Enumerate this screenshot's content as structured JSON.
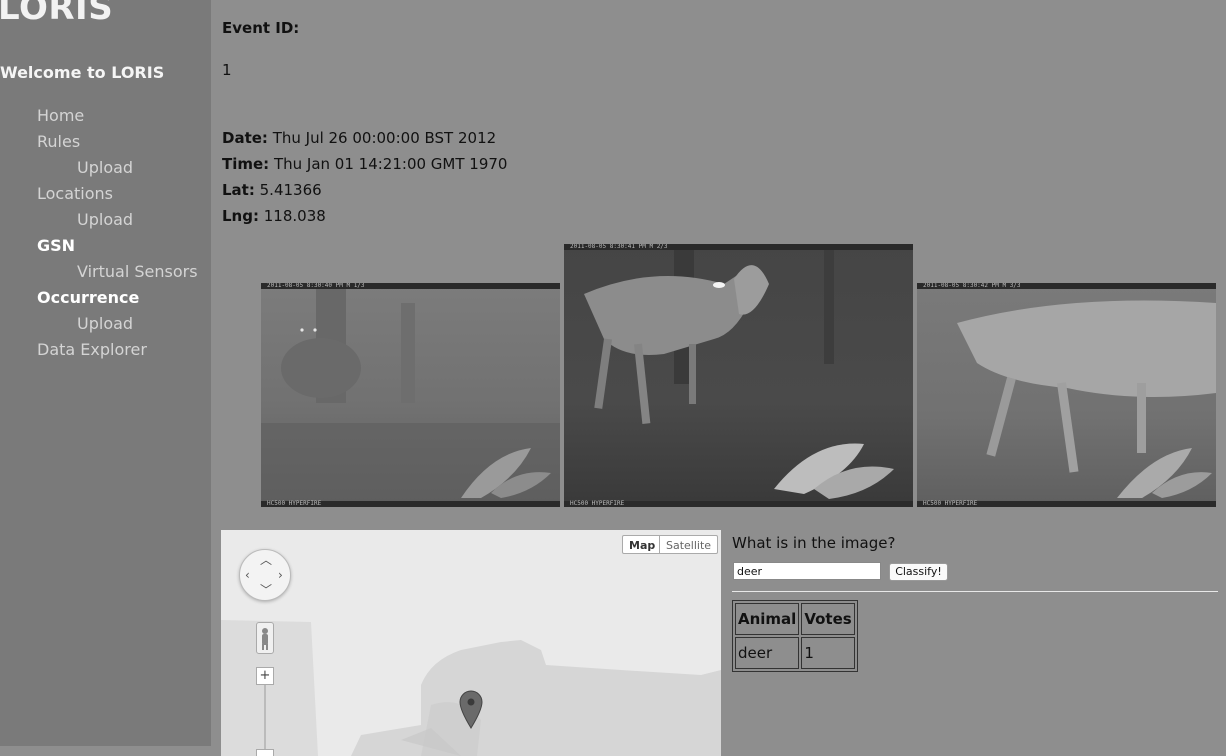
{
  "app": {
    "logo": "LORIS",
    "welcome": "Welcome to LORIS"
  },
  "nav": {
    "home": "Home",
    "rules": "Rules",
    "rules_upload": "Upload",
    "locations": "Locations",
    "locations_upload": "Upload",
    "gsn": "GSN",
    "virtual_sensors": "Virtual Sensors",
    "occurrence": "Occurrence",
    "occurrence_upload": "Upload",
    "data_explorer": "Data Explorer"
  },
  "event": {
    "id_label": "Event ID:",
    "id_value": "1",
    "date_label": "Date:",
    "date_value": "Thu Jul 26 00:00:00 BST 2012",
    "time_label": "Time:",
    "time_value": "Thu Jan 01 14:21:00 GMT 1970",
    "lat_label": "Lat:",
    "lat_value": "5.41366",
    "lng_label": "Lng:",
    "lng_value": "118.038"
  },
  "photos": [
    {
      "stamp": "2011-08-05 8:30:40 PM   M 1/3",
      "footer": "HC500 HYPERFIRE"
    },
    {
      "stamp": "2011-08-05 8:30:41 PM   M 2/3",
      "footer": "HC500 HYPERFIRE"
    },
    {
      "stamp": "2011-08-05 8:30:42 PM   M 3/3",
      "footer": "HC500 HYPERFIRE"
    }
  ],
  "map": {
    "type_map": "Map",
    "type_satellite": "Satellite"
  },
  "classify": {
    "question": "What is in the image?",
    "input_value": "deer",
    "button": "Classify!"
  },
  "votes_table": {
    "headers": [
      "Animal",
      "Votes"
    ],
    "rows": [
      [
        "deer",
        "1"
      ]
    ]
  },
  "colors": {
    "page_bg": "#8e8e8e",
    "sidebar_bg": "#7a7a7a",
    "nav_text": "#d4d4d4",
    "nav_active": "#ffffff"
  }
}
